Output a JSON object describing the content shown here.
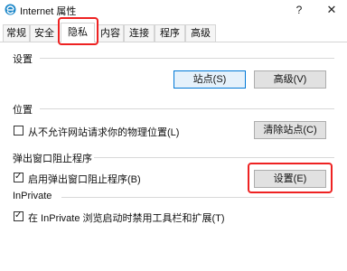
{
  "window": {
    "title": "Internet 属性",
    "help": "?",
    "close": "✕"
  },
  "tabs": [
    "常规",
    "安全",
    "隐私",
    "内容",
    "连接",
    "程序",
    "高级"
  ],
  "active_tab": "隐私",
  "settings_group": {
    "label": "设置",
    "sites_button": "站点(S)",
    "advanced_button": "高级(V)"
  },
  "location_group": {
    "label": "位置",
    "checkbox_label": "从不允许网站请求你的物理位置(L)",
    "checkbox_checked": false,
    "clear_button": "清除站点(C)"
  },
  "popup_group": {
    "label": "弹出窗口阻止程序",
    "checkbox_label": "启用弹出窗口阻止程序(B)",
    "checkbox_checked": true,
    "settings_button": "设置(E)"
  },
  "inprivate_group": {
    "label": "InPrivate",
    "checkbox_label": "在 InPrivate 浏览启动时禁用工具栏和扩展(T)",
    "checkbox_checked": true
  },
  "colors": {
    "highlight": "#e22222",
    "focus_border": "#0078d7"
  },
  "icons": {
    "app": "internet-globe-icon",
    "check": "✓"
  }
}
